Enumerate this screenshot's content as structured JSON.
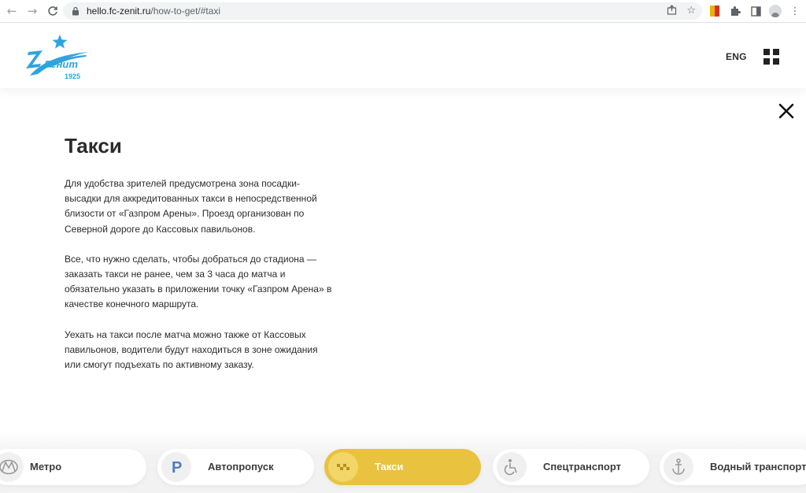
{
  "browser": {
    "back_icon": "arrow-left-icon",
    "forward_icon": "arrow-right-icon",
    "reload_icon": "reload-icon",
    "url_host": "hello.fc-zenit.ru",
    "url_path": "/how-to-get/#taxi"
  },
  "header": {
    "logo_text": "Зенит",
    "logo_year": "1925",
    "lang_label": "ENG",
    "brand_color": "#2fa4dc"
  },
  "content": {
    "title": "Такси",
    "paragraphs": [
      "Для удобства зрителей предусмотрена зона посадки-высадки для аккредитованных такси в непосредственной близости от «Газпром Арены». Проезд организован по Северной дороге до Кассовых павильонов.",
      "Все, что нужно сделать, чтобы добраться до стадиона — заказать такси не ранее, чем за 3 часа до матча и обязательно указать в приложении точку «Газпром Арена» в качестве конечного маршрута.",
      "Уехать на такси после матча можно также от Кассовых павильонов, водители будут находиться в зоне ожидания или смогут подъехать по активному заказу."
    ]
  },
  "tabs": [
    {
      "label": "Метро",
      "icon": "metro-icon",
      "active": false
    },
    {
      "label": "Автопропуск",
      "icon": "parking-icon",
      "active": false
    },
    {
      "label": "Такси",
      "icon": "taxi-checker-icon",
      "active": true
    },
    {
      "label": "Спецтранспорт",
      "icon": "wheelchair-icon",
      "active": false
    },
    {
      "label": "Водный транспорт",
      "icon": "anchor-icon",
      "active": false
    }
  ],
  "colors": {
    "active_tab": "#e9c23f",
    "text": "#2b2b2b"
  }
}
